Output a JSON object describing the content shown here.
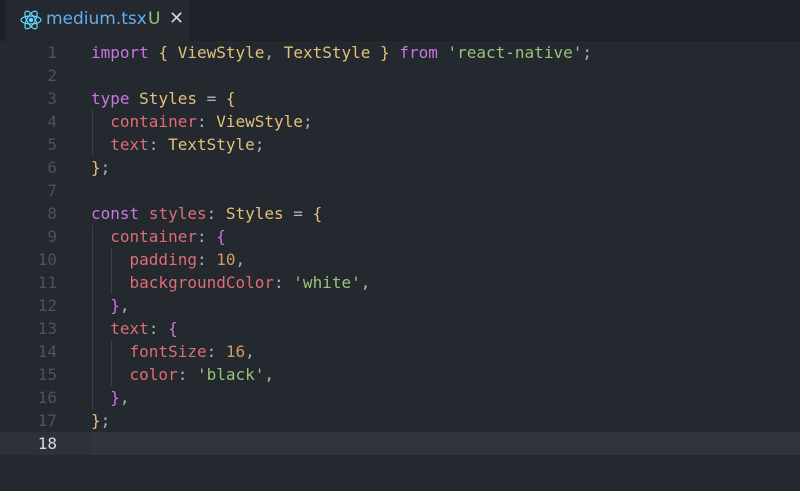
{
  "tab": {
    "filename": "medium.tsx",
    "status": "U",
    "close_glyph": "✕",
    "icon": "react-icon",
    "icon_color": "#61dafb"
  },
  "editor": {
    "current_line": 18,
    "lines": [
      {
        "n": "1",
        "tokens": [
          [
            "kw",
            "import"
          ],
          [
            "p",
            " "
          ],
          [
            "b1",
            "{"
          ],
          [
            "p",
            " "
          ],
          [
            "type",
            "ViewStyle"
          ],
          [
            "p",
            ", "
          ],
          [
            "type",
            "TextStyle"
          ],
          [
            "p",
            " "
          ],
          [
            "b1",
            "}"
          ],
          [
            "p",
            " "
          ],
          [
            "kw",
            "from"
          ],
          [
            "p",
            " "
          ],
          [
            "str",
            "'react-native'"
          ],
          [
            "p",
            ";"
          ]
        ]
      },
      {
        "n": "2",
        "tokens": []
      },
      {
        "n": "3",
        "tokens": [
          [
            "kw",
            "type"
          ],
          [
            "p",
            " "
          ],
          [
            "type",
            "Styles"
          ],
          [
            "p",
            " = "
          ],
          [
            "b1",
            "{"
          ]
        ]
      },
      {
        "n": "4",
        "tokens": [
          [
            "p",
            "  "
          ],
          [
            "prop",
            "container"
          ],
          [
            "p",
            ": "
          ],
          [
            "type",
            "ViewStyle"
          ],
          [
            "p",
            ";"
          ]
        ]
      },
      {
        "n": "5",
        "tokens": [
          [
            "p",
            "  "
          ],
          [
            "prop",
            "text"
          ],
          [
            "p",
            ": "
          ],
          [
            "type",
            "TextStyle"
          ],
          [
            "p",
            ";"
          ]
        ]
      },
      {
        "n": "6",
        "tokens": [
          [
            "b1",
            "}"
          ],
          [
            "p",
            ";"
          ]
        ]
      },
      {
        "n": "7",
        "tokens": []
      },
      {
        "n": "8",
        "tokens": [
          [
            "kw",
            "const"
          ],
          [
            "p",
            " "
          ],
          [
            "var",
            "styles"
          ],
          [
            "p",
            ": "
          ],
          [
            "type",
            "Styles"
          ],
          [
            "p",
            " = "
          ],
          [
            "b1",
            "{"
          ]
        ]
      },
      {
        "n": "9",
        "tokens": [
          [
            "p",
            "  "
          ],
          [
            "prop",
            "container"
          ],
          [
            "p",
            ": "
          ],
          [
            "b2",
            "{"
          ]
        ]
      },
      {
        "n": "10",
        "tokens": [
          [
            "p",
            "    "
          ],
          [
            "prop",
            "padding"
          ],
          [
            "p",
            ": "
          ],
          [
            "num",
            "10"
          ],
          [
            "p",
            ","
          ]
        ]
      },
      {
        "n": "11",
        "tokens": [
          [
            "p",
            "    "
          ],
          [
            "prop",
            "backgroundColor"
          ],
          [
            "p",
            ": "
          ],
          [
            "str",
            "'white'"
          ],
          [
            "p",
            ","
          ]
        ]
      },
      {
        "n": "12",
        "tokens": [
          [
            "p",
            "  "
          ],
          [
            "b2",
            "}"
          ],
          [
            "p",
            ","
          ]
        ]
      },
      {
        "n": "13",
        "tokens": [
          [
            "p",
            "  "
          ],
          [
            "prop",
            "text"
          ],
          [
            "p",
            ": "
          ],
          [
            "b2",
            "{"
          ]
        ]
      },
      {
        "n": "14",
        "tokens": [
          [
            "p",
            "    "
          ],
          [
            "prop",
            "fontSize"
          ],
          [
            "p",
            ": "
          ],
          [
            "num",
            "16"
          ],
          [
            "p",
            ","
          ]
        ]
      },
      {
        "n": "15",
        "tokens": [
          [
            "p",
            "    "
          ],
          [
            "prop",
            "color"
          ],
          [
            "p",
            ": "
          ],
          [
            "str",
            "'black'"
          ],
          [
            "p",
            ","
          ]
        ]
      },
      {
        "n": "16",
        "tokens": [
          [
            "p",
            "  "
          ],
          [
            "b2",
            "}"
          ],
          [
            "p",
            ","
          ]
        ]
      },
      {
        "n": "17",
        "tokens": [
          [
            "b1",
            "}"
          ],
          [
            "p",
            ";"
          ]
        ]
      },
      {
        "n": "18",
        "tokens": []
      }
    ]
  }
}
